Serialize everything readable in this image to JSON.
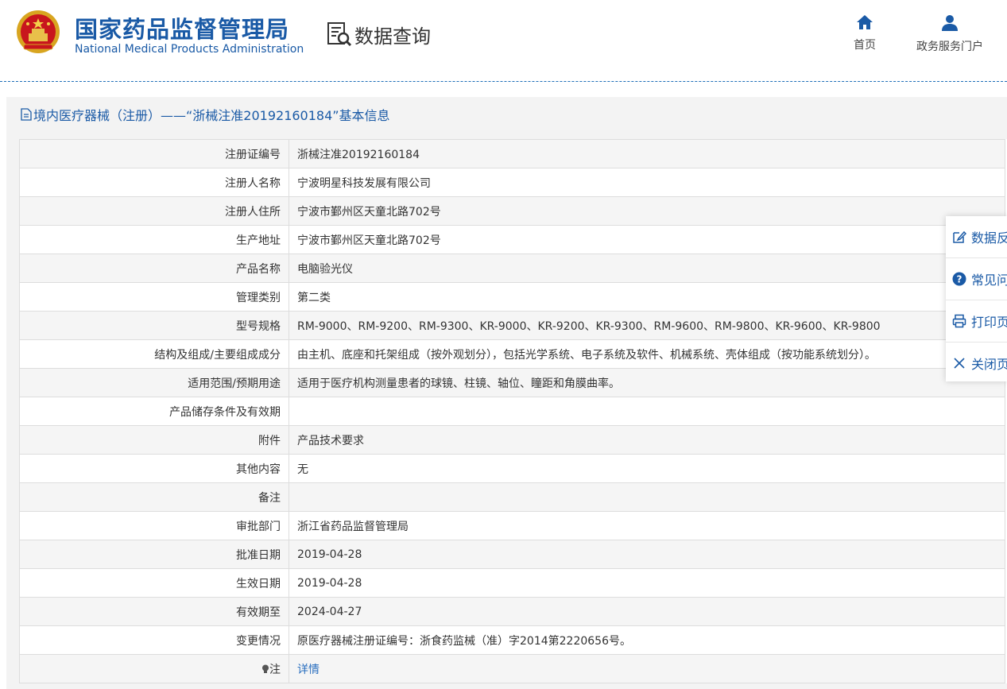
{
  "header": {
    "org_cn": "国家药品监督管理局",
    "org_en": "National Medical Products Administration",
    "section": "数据查询",
    "nav": [
      {
        "label": "首页",
        "icon": "home-icon"
      },
      {
        "label": "政务服务门户",
        "icon": "user-icon"
      }
    ]
  },
  "panel": {
    "title": "境内医疗器械（注册）——“浙械注准20192160184”基本信息"
  },
  "rows": [
    {
      "label": "注册证编号",
      "value": "浙械注准20192160184"
    },
    {
      "label": "注册人名称",
      "value": "宁波明星科技发展有限公司"
    },
    {
      "label": "注册人住所",
      "value": "宁波市鄞州区天童北路702号"
    },
    {
      "label": "生产地址",
      "value": "宁波市鄞州区天童北路702号"
    },
    {
      "label": "产品名称",
      "value": "电脑验光仪"
    },
    {
      "label": "管理类别",
      "value": "第二类"
    },
    {
      "label": "型号规格",
      "value": "RM-9000、RM-9200、RM-9300、KR-9000、KR-9200、KR-9300、RM-9600、RM-9800、KR-9600、KR-9800"
    },
    {
      "label": "结构及组成/主要组成成分",
      "value": "由主机、底座和托架组成（按外观划分），包括光学系统、电子系统及软件、机械系统、壳体组成（按功能系统划分）。"
    },
    {
      "label": "适用范围/预期用途",
      "value": "适用于医疗机构测量患者的球镜、柱镜、轴位、瞳距和角膜曲率。"
    },
    {
      "label": "产品储存条件及有效期",
      "value": ""
    },
    {
      "label": "附件",
      "value": "产品技术要求"
    },
    {
      "label": "其他内容",
      "value": "无"
    },
    {
      "label": "备注",
      "value": ""
    },
    {
      "label": "审批部门",
      "value": "浙江省药品监督管理局"
    },
    {
      "label": "批准日期",
      "value": "2019-04-28"
    },
    {
      "label": "生效日期",
      "value": "2019-04-28"
    },
    {
      "label": "有效期至",
      "value": "2024-04-27"
    },
    {
      "label": "变更情况",
      "value": "原医疗器械注册证编号：浙食药监械（准）字2014第2220656号。"
    }
  ],
  "note_row": {
    "label": "注",
    "link": "详情"
  },
  "float_menu": [
    {
      "label": "数据反",
      "icon": "edit-icon"
    },
    {
      "label": "常见问",
      "icon": "question-icon"
    },
    {
      "label": "打印页",
      "icon": "print-icon"
    },
    {
      "label": "关闭页",
      "icon": "close-icon"
    }
  ]
}
